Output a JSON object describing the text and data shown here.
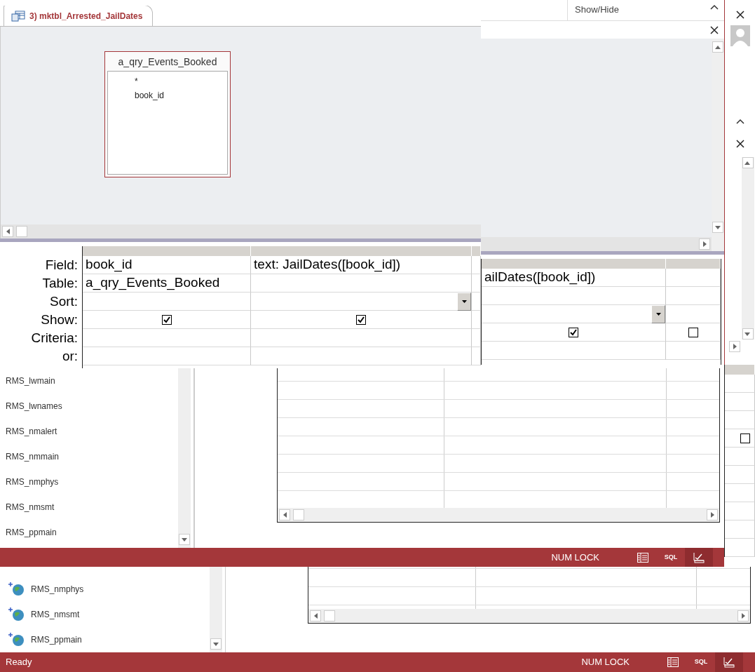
{
  "back_window": {
    "navigation_items": [
      {
        "label": "RMS_nmphys"
      },
      {
        "label": "RMS_nmsmt"
      },
      {
        "label": "RMS_ppmain"
      }
    ],
    "design_grid": {
      "columns": [
        {
          "show": false
        }
      ]
    },
    "status_bar": {
      "message": "Ready",
      "num_lock": "NUM LOCK",
      "view_buttons": [
        {
          "kind": "datasheet",
          "selected": false
        },
        {
          "kind": "sql",
          "label": "SQL",
          "selected": false
        },
        {
          "kind": "design",
          "selected": true
        }
      ]
    }
  },
  "middle_window": {
    "ribbon_group": "Show/Hide",
    "design_grid": {
      "columns": [
        {
          "field": "ailDates([book_id])",
          "sort_dropdown": true,
          "show": true
        },
        {
          "show": false
        }
      ]
    },
    "navigation_items": [
      {
        "label": "RMS_lwmain"
      },
      {
        "label": "RMS_lwnames"
      },
      {
        "label": "RMS_nmalert"
      },
      {
        "label": "RMS_nmmain"
      },
      {
        "label": "RMS_nmphys"
      },
      {
        "label": "RMS_nmsmt"
      },
      {
        "label": "RMS_ppmain"
      }
    ],
    "status_bar": {
      "num_lock": "NUM LOCK",
      "view_buttons": [
        {
          "kind": "datasheet",
          "selected": false
        },
        {
          "kind": "sql",
          "label": "SQL",
          "selected": false
        },
        {
          "kind": "design",
          "selected": true
        }
      ]
    }
  },
  "front_window": {
    "tab": {
      "title": "3) mktbl_Arrested_JailDates",
      "selected": true
    },
    "field_list": {
      "title": "a_qry_Events_Booked",
      "fields": [
        "*",
        "book_id"
      ]
    },
    "design_grid": {
      "row_labels": [
        "Field:",
        "Table:",
        "Sort:",
        "Show:",
        "Criteria:",
        "or:"
      ],
      "columns": [
        {
          "field": "book_id",
          "table": "a_qry_Events_Booked",
          "show": true
        },
        {
          "field": "text: JailDates([book_id])",
          "sort_dropdown": true,
          "show": true
        }
      ]
    }
  }
}
